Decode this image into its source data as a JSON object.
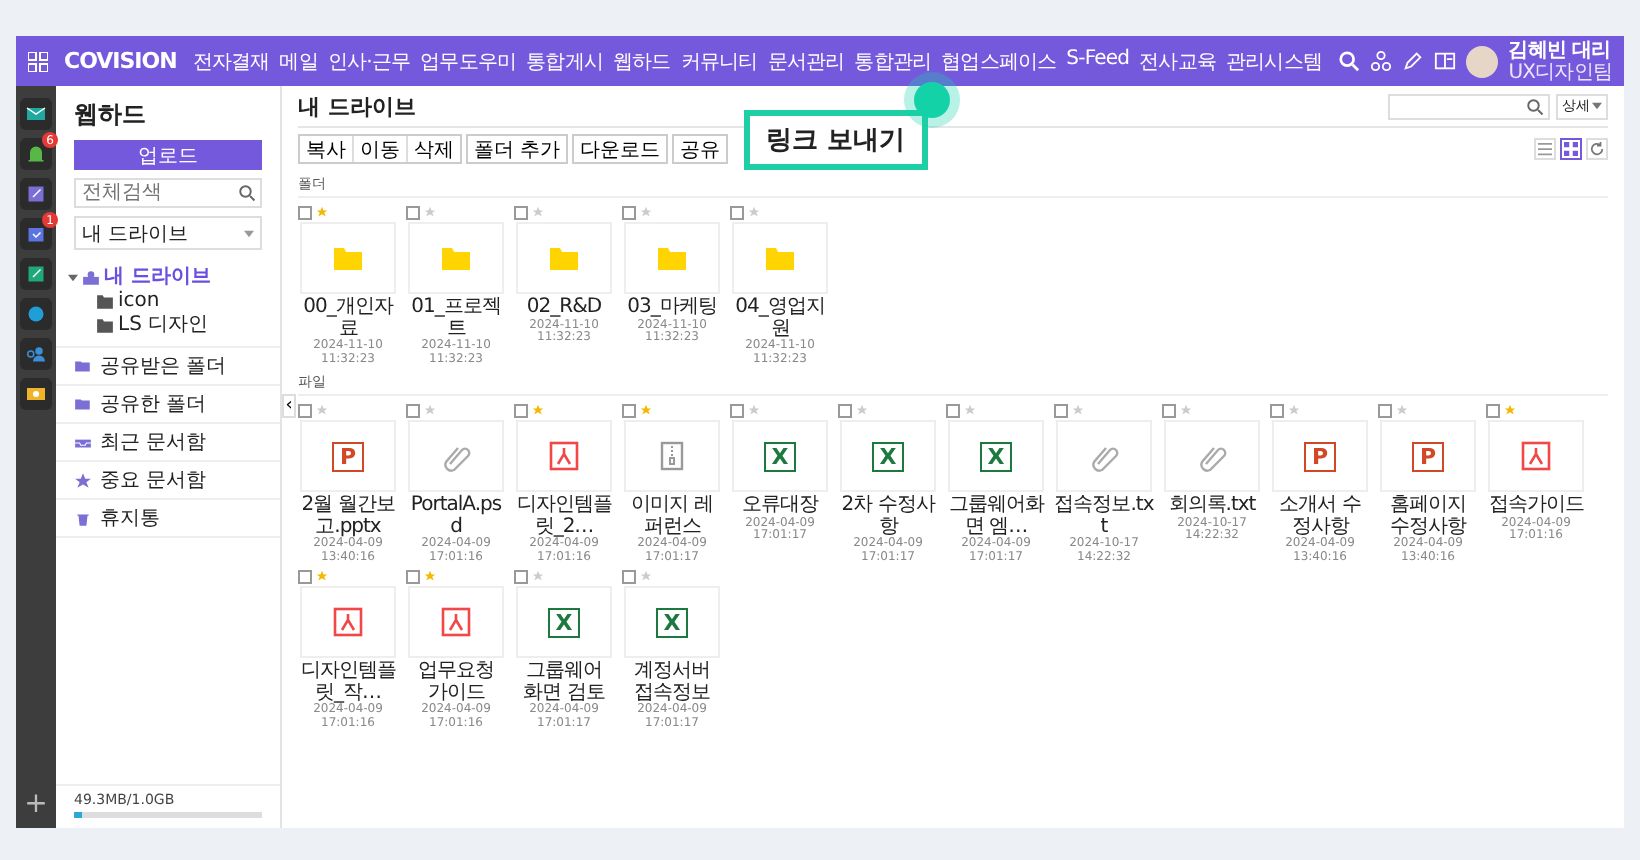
{
  "topbar": {
    "logo": "COVISION",
    "menu": [
      "전자결재",
      "메일",
      "인사·근무",
      "업무도우미",
      "통합게시",
      "웹하드",
      "커뮤니티",
      "문서관리",
      "통합관리",
      "협업스페이스",
      "S-Feed",
      "전사교육",
      "관리시스템"
    ],
    "user": {
      "name": "김혜빈 대리",
      "team": "UX디자인팀"
    }
  },
  "rail": {
    "apps": [
      {
        "kind": "mail",
        "color": "#1fa9a0"
      },
      {
        "kind": "bell",
        "color": "#57b848",
        "badge": "6"
      },
      {
        "kind": "note",
        "color": "#7b6fd6"
      },
      {
        "kind": "calendar",
        "color": "#5b74e0",
        "badge": "1"
      },
      {
        "kind": "note",
        "color": "#1fa97a"
      },
      {
        "kind": "circle",
        "color": "#1e9fd8"
      },
      {
        "kind": "people",
        "color": "#3a8fd8"
      },
      {
        "kind": "card",
        "color": "#f0b429"
      }
    ],
    "add": "+"
  },
  "sidebar": {
    "title": "웹하드",
    "upload": "업로드",
    "search": {
      "placeholder": "전체검색"
    },
    "drive_select": "내 드라이브",
    "tree": [
      {
        "label": "내 드라이브",
        "selected": true,
        "expanded": true,
        "children": [
          {
            "label": "icon",
            "selected": false
          },
          {
            "label": "LS 디자인",
            "selected": false
          }
        ]
      }
    ],
    "menu": [
      {
        "label": "공유받은 폴더",
        "kind": "folder"
      },
      {
        "label": "공유한 폴더",
        "kind": "folder"
      },
      {
        "label": "최근 문서함",
        "kind": "tray"
      },
      {
        "label": "중요 문서함",
        "kind": "star"
      },
      {
        "label": "휴지통",
        "kind": "trash"
      }
    ],
    "storage": {
      "text": "49.3MB/1.0GB",
      "level": 0.04
    },
    "collapse": "‹"
  },
  "main": {
    "title": "내 드라이브",
    "view_select": "상세",
    "toolbar": [
      [
        "복사",
        "이동",
        "삭제"
      ],
      [
        "폴더 추가"
      ],
      [
        "다운로드"
      ],
      [
        "공유"
      ]
    ],
    "callout": "링크 보내기",
    "views": [
      {
        "kind": "list",
        "selected": false
      },
      {
        "kind": "grid",
        "selected": true
      }
    ],
    "folders_label": "폴더",
    "folders": [
      {
        "name": "00_개인자료",
        "date": "2024-11-10",
        "time": "11:32:23",
        "starred": true,
        "checked": false
      },
      {
        "name": "01_프로젝트",
        "date": "2024-11-10",
        "time": "11:32:23",
        "starred": false,
        "checked": false
      },
      {
        "name": "02_R&D",
        "date": "2024-11-10",
        "time": "11:32:23",
        "starred": false,
        "checked": false
      },
      {
        "name": "03_마케팅",
        "date": "2024-11-10",
        "time": "11:32:23",
        "starred": false,
        "checked": false
      },
      {
        "name": "04_영업지원",
        "date": "2024-11-10",
        "time": "11:32:23",
        "starred": false,
        "checked": false
      }
    ],
    "files_label": "파일",
    "files": [
      {
        "name": "2월 월간보고.pptx",
        "kind": "ppt",
        "glyph": "P",
        "date": "2024-04-09",
        "time": "13:40:16",
        "starred": false,
        "checked": false
      },
      {
        "name": "PortalA.psd",
        "kind": "attach",
        "date": "2024-04-09",
        "time": "17:01:16",
        "starred": false,
        "checked": false
      },
      {
        "name": "디자인템플릿_2…",
        "kind": "pdf",
        "date": "2024-04-09",
        "time": "17:01:16",
        "starred": true,
        "checked": false
      },
      {
        "name": "이미지 레퍼런스",
        "kind": "zip",
        "date": "2024-04-09",
        "time": "17:01:17",
        "starred": true,
        "checked": false
      },
      {
        "name": "오류대장",
        "kind": "xls",
        "glyph": "X",
        "date": "2024-04-09",
        "time": "17:01:17",
        "starred": false,
        "checked": false
      },
      {
        "name": "2차 수정사항",
        "kind": "xls",
        "glyph": "X",
        "date": "2024-04-09",
        "time": "17:01:17",
        "starred": false,
        "checked": false
      },
      {
        "name": "그룹웨어화면 엠…",
        "kind": "xls",
        "glyph": "X",
        "date": "2024-04-09",
        "time": "17:01:17",
        "starred": false,
        "checked": false
      },
      {
        "name": "접속정보.txt",
        "kind": "attach",
        "date": "2024-10-17",
        "time": "14:22:32",
        "starred": false,
        "checked": false
      },
      {
        "name": "회의록.txt",
        "kind": "attach",
        "date": "2024-10-17",
        "time": "14:22:32",
        "starred": false,
        "checked": false
      },
      {
        "name": "소개서 수정사항",
        "kind": "ppt",
        "glyph": "P",
        "date": "2024-04-09",
        "time": "13:40:16",
        "starred": false,
        "checked": false
      },
      {
        "name": "홈페이지 수정사항",
        "kind": "ppt",
        "glyph": "P",
        "date": "2024-04-09",
        "time": "13:40:16",
        "starred": false,
        "checked": false
      },
      {
        "name": "접속가이드",
        "kind": "pdf",
        "date": "2024-04-09",
        "time": "17:01:16",
        "starred": true,
        "checked": false
      },
      {
        "name": "디자인템플릿_작…",
        "kind": "pdf",
        "date": "2024-04-09",
        "time": "17:01:16",
        "starred": true,
        "checked": false
      },
      {
        "name": "업무요청 가이드",
        "kind": "pdf",
        "date": "2024-04-09",
        "time": "17:01:16",
        "starred": true,
        "checked": false
      },
      {
        "name": "그룹웨어 화면 검토",
        "kind": "xls",
        "glyph": "X",
        "date": "2024-04-09",
        "time": "17:01:17",
        "starred": false,
        "checked": false
      },
      {
        "name": "계정서버 접속정보",
        "kind": "xls",
        "glyph": "X",
        "date": "2024-04-09",
        "time": "17:01:17",
        "starred": false,
        "checked": false
      }
    ]
  }
}
